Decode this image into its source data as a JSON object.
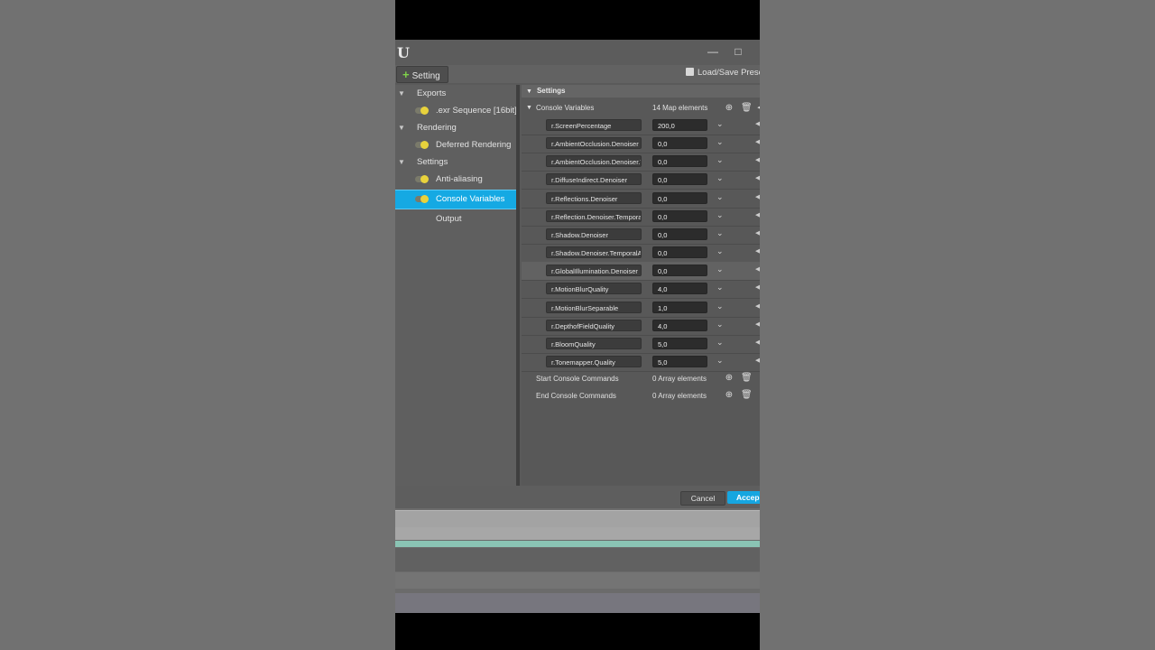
{
  "window": {
    "title_controls": [
      "—",
      "□"
    ],
    "toolbar": {
      "add_label": "Setting",
      "presets_label": "Load/Save Prese"
    }
  },
  "tree": {
    "items": [
      {
        "label": "Exports",
        "kind": "category"
      },
      {
        "label": ".exr Sequence [16bit]",
        "kind": "setting"
      },
      {
        "label": "Rendering",
        "kind": "category"
      },
      {
        "label": "Deferred Rendering",
        "kind": "setting"
      },
      {
        "label": "Settings",
        "kind": "category"
      },
      {
        "label": "Anti-aliasing",
        "kind": "setting"
      },
      {
        "label": "Console Variables",
        "kind": "setting",
        "selected": true
      },
      {
        "label": "Output",
        "kind": "plain"
      }
    ]
  },
  "panel": {
    "section_title": "Settings",
    "console_variables": {
      "label": "Console Variables",
      "count": "14 Map elements",
      "rows": [
        {
          "key": "r.ScreenPercentage",
          "value": "200,0"
        },
        {
          "key": "r.AmbientOcclusion.Denoiser",
          "value": "0,0"
        },
        {
          "key": "r.AmbientOcclusion.Denoiser.TemporalAccumulation",
          "value": "0,0"
        },
        {
          "key": "r.DiffuseIndirect.Denoiser",
          "value": "0,0"
        },
        {
          "key": "r.Reflections.Denoiser",
          "value": "0,0"
        },
        {
          "key": "r.Reflection.Denoiser.TemporalAccumulation",
          "value": "0,0"
        },
        {
          "key": "r.Shadow.Denoiser",
          "value": "0,0"
        },
        {
          "key": "r.Shadow.Denoiser.TemporalAccumulation",
          "value": "0,0"
        },
        {
          "key": "r.GlobalIllumination.Denoiser",
          "value": "0,0"
        },
        {
          "key": "r.MotionBlurQuality",
          "value": "4,0"
        },
        {
          "key": "r.MotionBlurSeparable",
          "value": "1,0"
        },
        {
          "key": "r.DepthofFieldQuality",
          "value": "4,0"
        },
        {
          "key": "r.BloomQuality",
          "value": "5,0"
        },
        {
          "key": "r.Tonemapper.Quality",
          "value": "5,0"
        }
      ]
    },
    "start_commands": {
      "label": "Start Console Commands",
      "count": "0 Array elements"
    },
    "end_commands": {
      "label": "End Console Commands",
      "count": "0 Array elements"
    }
  },
  "footer": {
    "cancel_label": "Cancel",
    "accept_label": "Accep"
  }
}
